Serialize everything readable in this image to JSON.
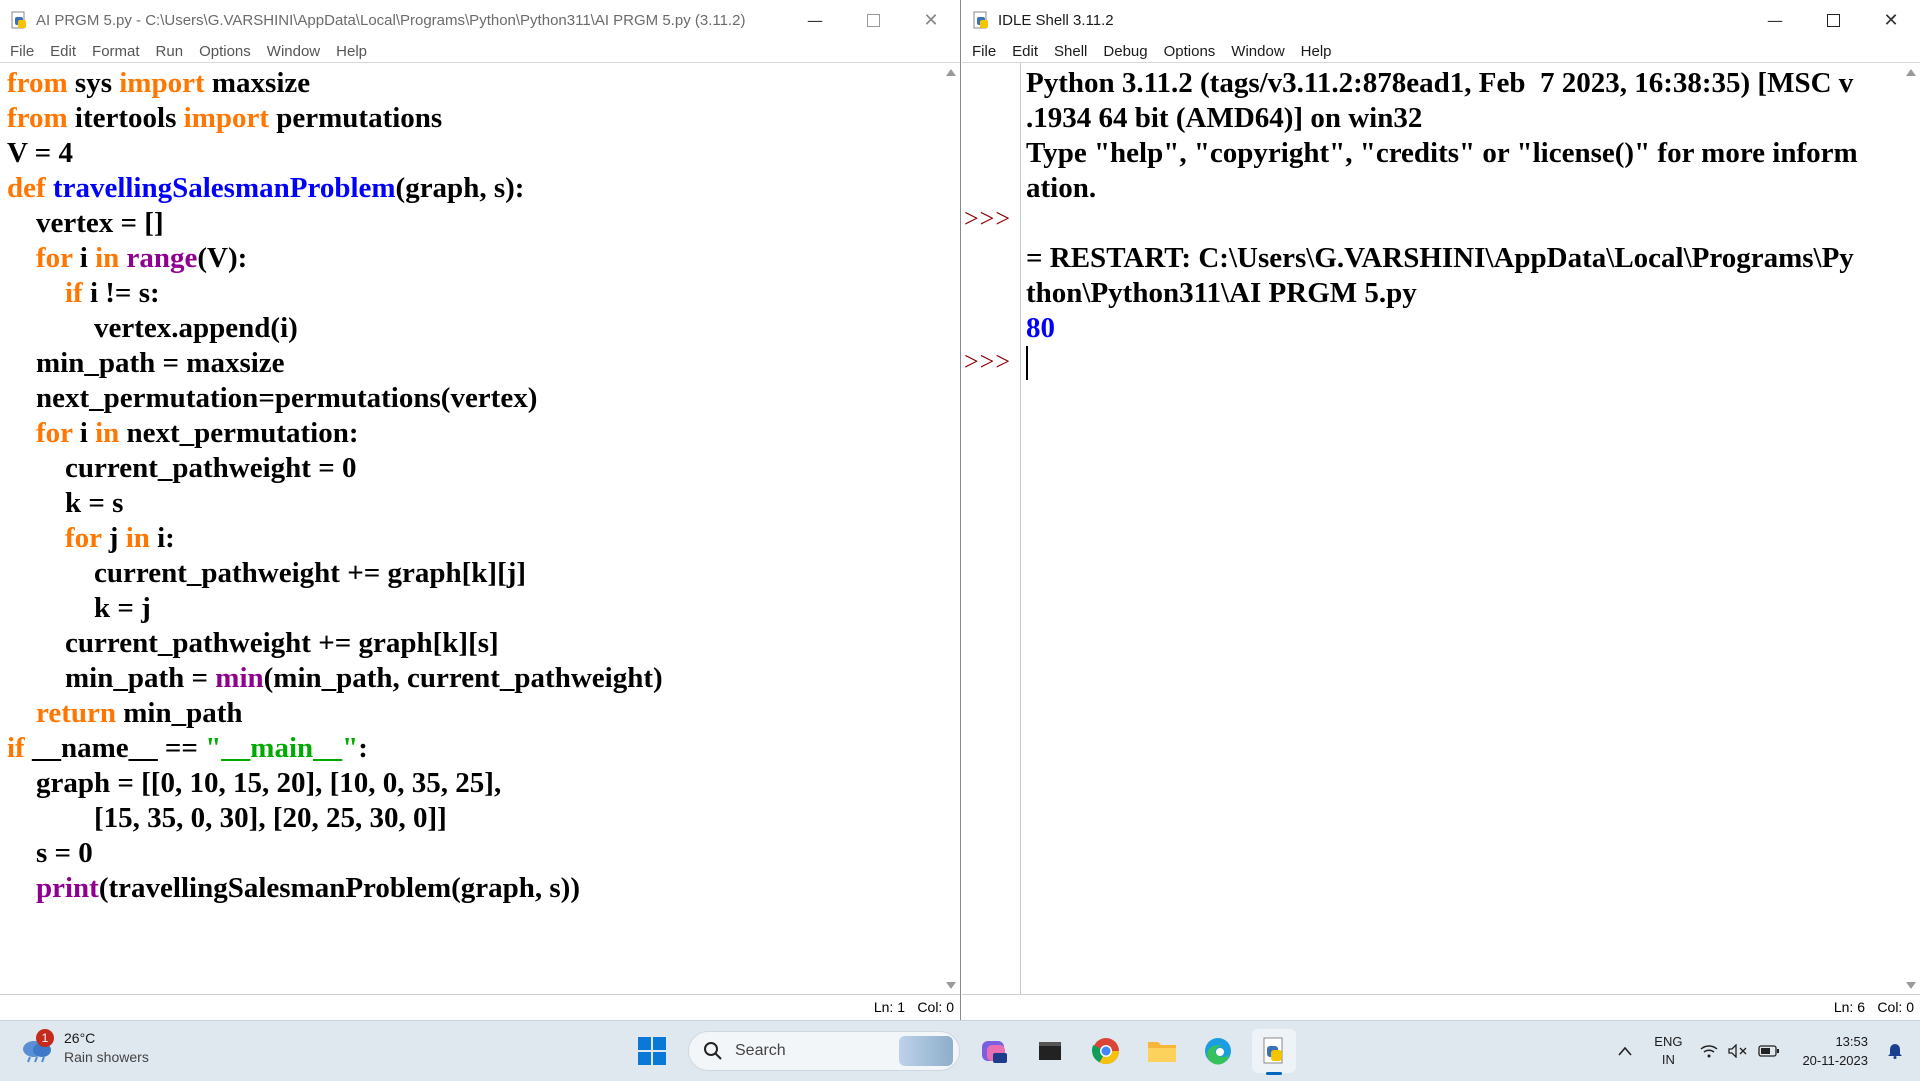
{
  "editor": {
    "title": "AI PRGM 5.py - C:\\Users\\G.VARSHINI\\AppData\\Local\\Programs\\Python\\Python311\\AI PRGM 5.py (3.11.2)",
    "menu": [
      "File",
      "Edit",
      "Format",
      "Run",
      "Options",
      "Window",
      "Help"
    ],
    "code_lines": [
      [
        [
          "kw",
          "from"
        ],
        [
          "t",
          " sys "
        ],
        [
          "kw",
          "import"
        ],
        [
          "t",
          " maxsize"
        ]
      ],
      [
        [
          "kw",
          "from"
        ],
        [
          "t",
          " itertools "
        ],
        [
          "kw",
          "import"
        ],
        [
          "t",
          " permutations"
        ]
      ],
      [
        [
          "t",
          "V = 4"
        ]
      ],
      [
        [
          "kw",
          "def"
        ],
        [
          "t",
          " "
        ],
        [
          "def",
          "travellingSalesmanProblem"
        ],
        [
          "t",
          "(graph, s):"
        ]
      ],
      [
        [
          "t",
          "    vertex = []"
        ]
      ],
      [
        [
          "t",
          "    "
        ],
        [
          "kw",
          "for"
        ],
        [
          "t",
          " i "
        ],
        [
          "kw",
          "in"
        ],
        [
          "t",
          " "
        ],
        [
          "bi",
          "range"
        ],
        [
          "t",
          "(V):"
        ]
      ],
      [
        [
          "t",
          "        "
        ],
        [
          "kw",
          "if"
        ],
        [
          "t",
          " i != s:"
        ]
      ],
      [
        [
          "t",
          "            vertex.append(i)"
        ]
      ],
      [
        [
          "t",
          "    min_path = maxsize"
        ]
      ],
      [
        [
          "t",
          "    next_permutation=permutations(vertex)"
        ]
      ],
      [
        [
          "t",
          "    "
        ],
        [
          "kw",
          "for"
        ],
        [
          "t",
          " i "
        ],
        [
          "kw",
          "in"
        ],
        [
          "t",
          " next_permutation:"
        ]
      ],
      [
        [
          "t",
          "        current_pathweight = 0"
        ]
      ],
      [
        [
          "t",
          "        k = s"
        ]
      ],
      [
        [
          "t",
          "        "
        ],
        [
          "kw",
          "for"
        ],
        [
          "t",
          " j "
        ],
        [
          "kw",
          "in"
        ],
        [
          "t",
          " i:"
        ]
      ],
      [
        [
          "t",
          "            current_pathweight += graph[k][j]"
        ]
      ],
      [
        [
          "t",
          "            k = j"
        ]
      ],
      [
        [
          "t",
          "        current_pathweight += graph[k][s]"
        ]
      ],
      [
        [
          "t",
          "        min_path = "
        ],
        [
          "bi",
          "min"
        ],
        [
          "t",
          "(min_path, current_pathweight)"
        ]
      ],
      [
        [
          "t",
          "    "
        ],
        [
          "kw",
          "return"
        ],
        [
          "t",
          " min_path"
        ]
      ],
      [
        [
          "kw",
          "if"
        ],
        [
          "t",
          " __name__ == "
        ],
        [
          "str",
          "\"__main__\""
        ],
        [
          "t",
          ":"
        ]
      ],
      [
        [
          "t",
          "    graph = [[0, 10, 15, 20], [10, 0, 35, 25],"
        ]
      ],
      [
        [
          "t",
          "            [15, 35, 0, 30], [20, 25, 30, 0]]"
        ]
      ],
      [
        [
          "t",
          "    s = 0"
        ]
      ],
      [
        [
          "t",
          "    "
        ],
        [
          "bi",
          "print"
        ],
        [
          "t",
          "(travellingSalesmanProblem(graph, s))"
        ]
      ]
    ],
    "status": {
      "ln": "Ln: 1",
      "col": "Col: 0"
    }
  },
  "shell": {
    "title": "IDLE Shell 3.11.2",
    "menu": [
      "File",
      "Edit",
      "Shell",
      "Debug",
      "Options",
      "Window",
      "Help"
    ],
    "prompt": ">>>",
    "banner_lines": [
      "Python 3.11.2 (tags/v3.11.2:878ead1, Feb  7 2023, 16:38:35) [MSC v",
      ".1934 64 bit (AMD64)] on win32",
      "Type \"help\", \"copyright\", \"credits\" or \"license()\" for more inform",
      "ation."
    ],
    "restart_lines": [
      "= RESTART: C:\\Users\\G.VARSHINI\\AppData\\Local\\Programs\\Py",
      "thon\\Python311\\AI PRGM 5.py"
    ],
    "output": "80",
    "status": {
      "ln": "Ln: 6",
      "col": "Col: 0"
    }
  },
  "taskbar": {
    "weather": {
      "temp": "26°C",
      "desc": "Rain showers",
      "badge": "1"
    },
    "search_label": "Search",
    "apps": [
      "copilot-icon",
      "terminal-icon",
      "chrome-icon",
      "file-explorer-icon",
      "edge-icon",
      "python-idle-icon"
    ],
    "tray": {
      "lang1": "ENG",
      "lang2": "IN",
      "time": "13:53",
      "date": "20-11-2023"
    }
  },
  "colors": {
    "keyword": "#ff7700",
    "def": "#0000ff",
    "builtin": "#900090",
    "string": "#00aa00",
    "prompt": "#8b0000"
  }
}
